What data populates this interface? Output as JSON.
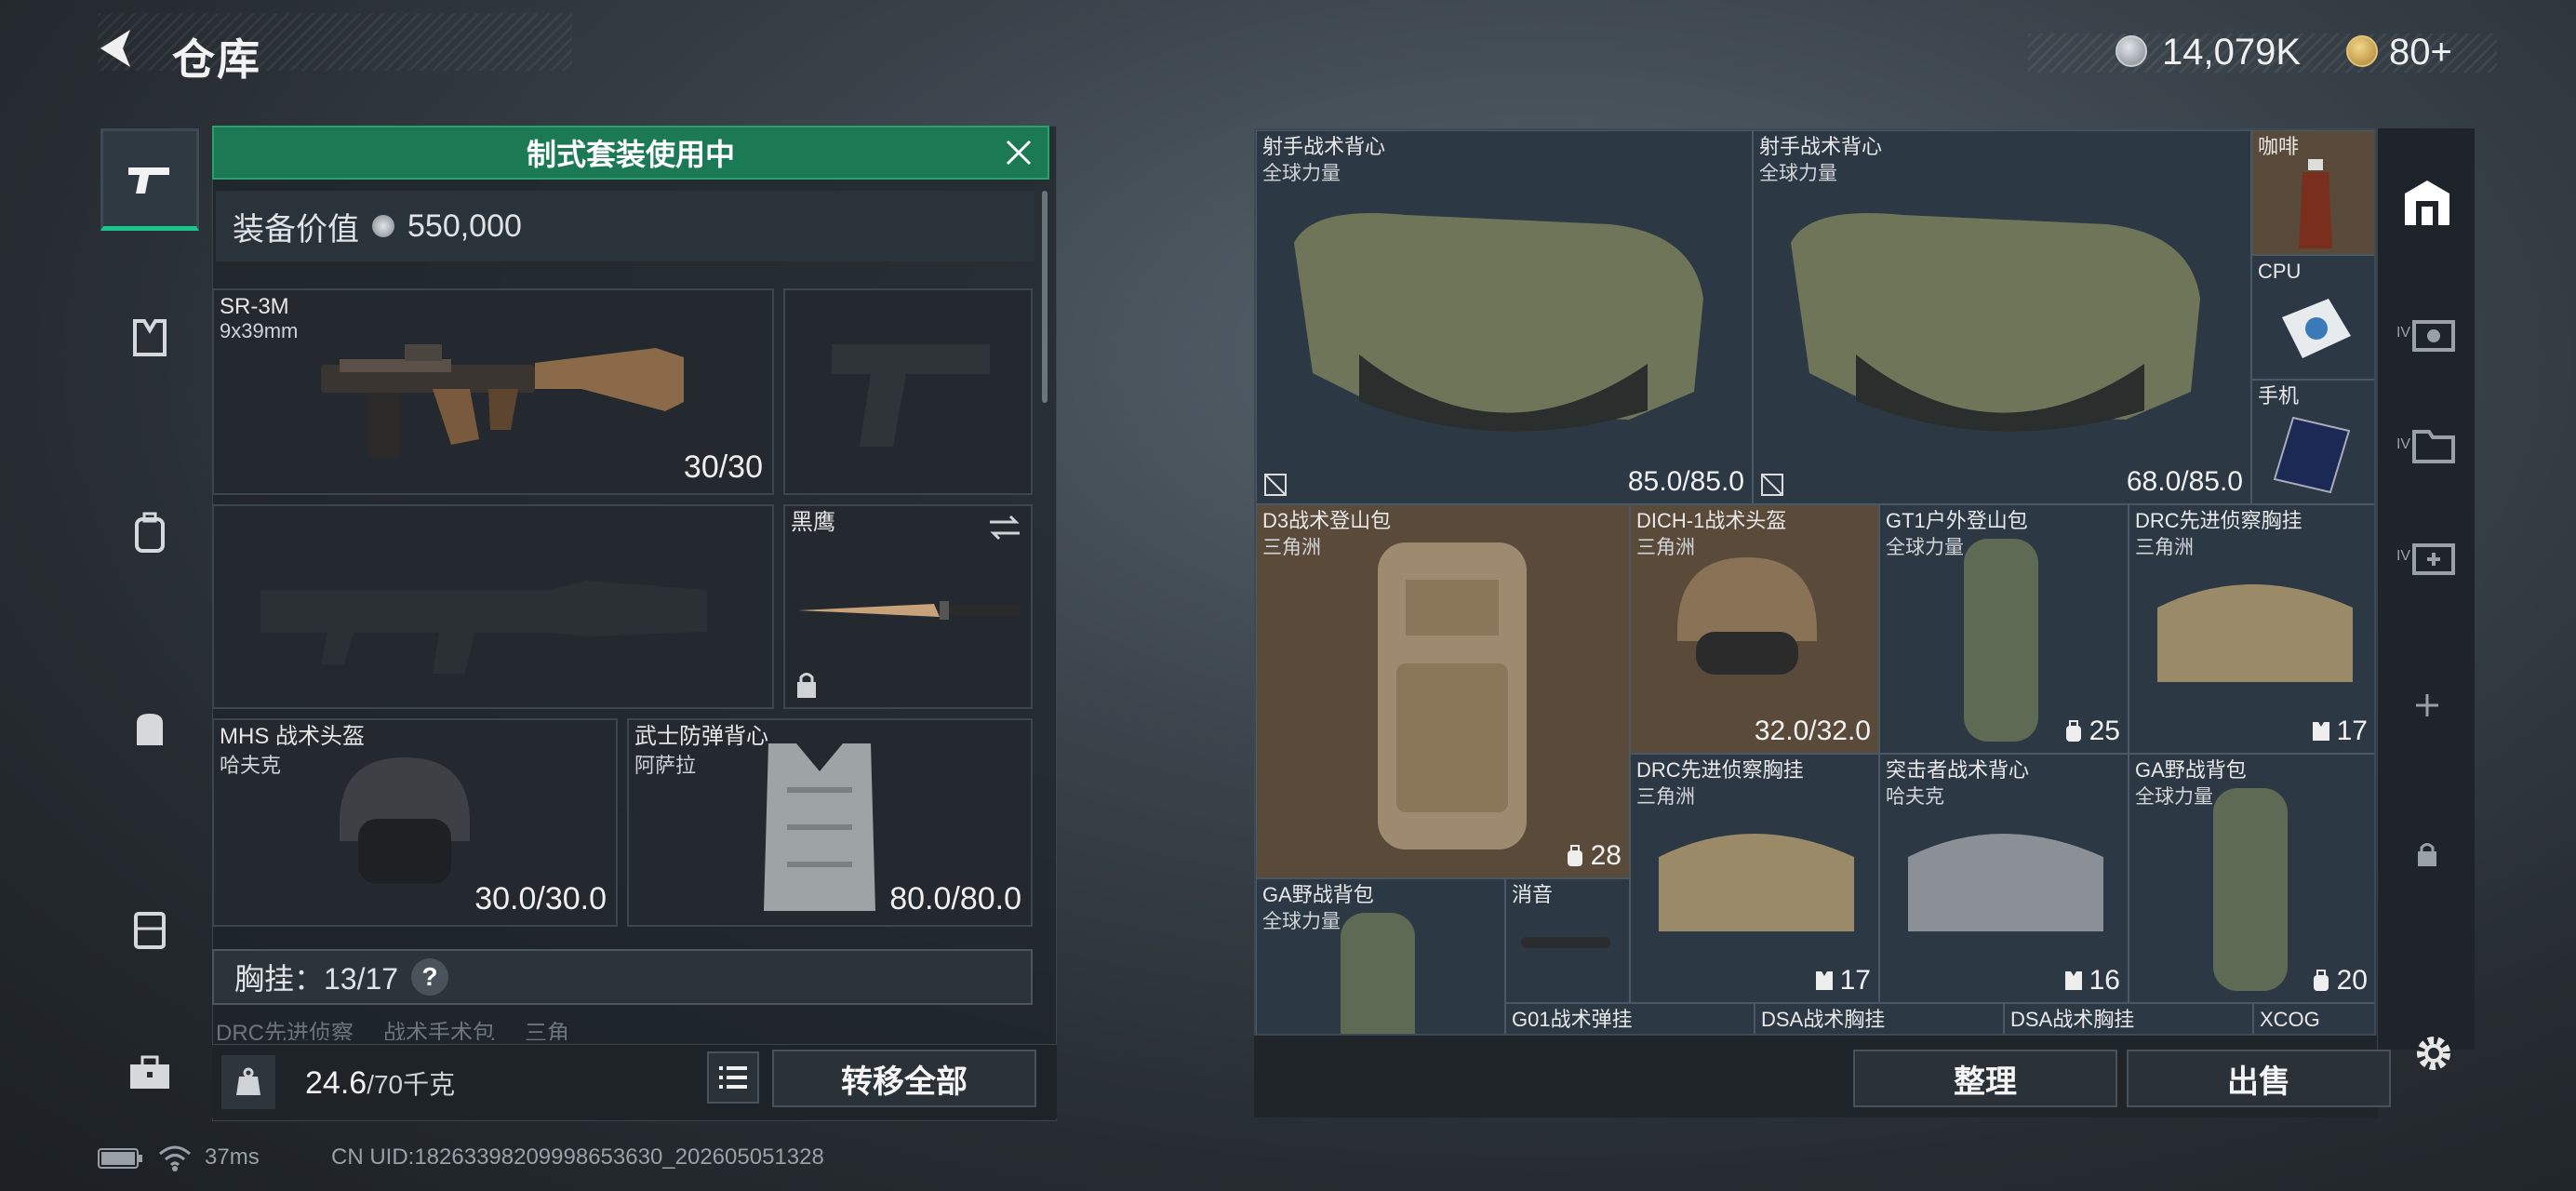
{
  "header": {
    "title": "仓库",
    "currency1": "14,079K",
    "currency2": "80+"
  },
  "loadout": {
    "banner": "制式套装使用中",
    "value_label": "装备价值",
    "value": "550,000",
    "primary": {
      "name": "SR-3M",
      "sub": "9x39mm",
      "durability": "30/30"
    },
    "melee": {
      "name": "黑鹰"
    },
    "helmet": {
      "name": "MHS 战术头盔",
      "sub": "哈夫克",
      "durability": "30.0/30.0"
    },
    "armor": {
      "name": "武士防弹背心",
      "sub": "阿萨拉",
      "durability": "80.0/80.0"
    },
    "chest_rig": {
      "label": "胸挂：13/17",
      "help": "?"
    },
    "hidden_row": [
      "DRC先进侦察",
      "战术手术包",
      "三角"
    ],
    "weight": "24.6",
    "weight_unit": "/70千克",
    "transfer_all": "转移全部"
  },
  "storage": {
    "items": [
      {
        "name": "射手战术背心",
        "sub": "全球力量",
        "value": "85.0/85.0"
      },
      {
        "name": "射手战术背心",
        "sub": "全球力量",
        "value": "68.0/85.0"
      },
      {
        "name": "咖啡"
      },
      {
        "name": "CPU"
      },
      {
        "name": "手机"
      },
      {
        "name": "D3战术登山包",
        "sub": "三角洲",
        "value": "28"
      },
      {
        "name": "DICH-1战术头盔",
        "sub": "三角洲",
        "value": "32.0/32.0"
      },
      {
        "name": "GT1户外登山包",
        "sub": "全球力量",
        "value": "25"
      },
      {
        "name": "DRC先进侦察胸挂",
        "sub": "三角洲",
        "value": "17"
      },
      {
        "name": "DRC先进侦察胸挂",
        "sub": "三角洲",
        "value": "17"
      },
      {
        "name": "突击者战术背心",
        "sub": "哈夫克",
        "value": "16"
      },
      {
        "name": "GA野战背包",
        "sub": "全球力量",
        "value": "20"
      },
      {
        "name": "GA野战背包",
        "sub": "全球力量"
      },
      {
        "name": "消音"
      },
      {
        "name": "G01战术弹挂"
      },
      {
        "name": "DSA战术胸挂"
      },
      {
        "name": "DSA战术胸挂"
      },
      {
        "name": "XCOG"
      }
    ],
    "sort_label": "整理",
    "sell_label": "出售",
    "side_tabs": [
      "IV",
      "IV",
      "IV"
    ]
  },
  "status": {
    "ping": "37ms",
    "uid": "CN UID:18263398209998653630_202605051328"
  },
  "colors": {
    "accent": "#18c58d",
    "banner": "#1b7a53",
    "item_brown": "#5a4a3a"
  },
  "icons": [
    "back-arrow-icon",
    "silver-coin-icon",
    "gold-coin-icon",
    "pistol-icon",
    "armor-icon",
    "backpack-icon",
    "bag-icon",
    "case-icon",
    "toolbox-icon",
    "close-icon",
    "swap-icon",
    "lock-icon",
    "help-icon",
    "weight-icon",
    "list-icon",
    "gear-icon",
    "plus-icon",
    "battery-icon",
    "wifi-icon"
  ]
}
